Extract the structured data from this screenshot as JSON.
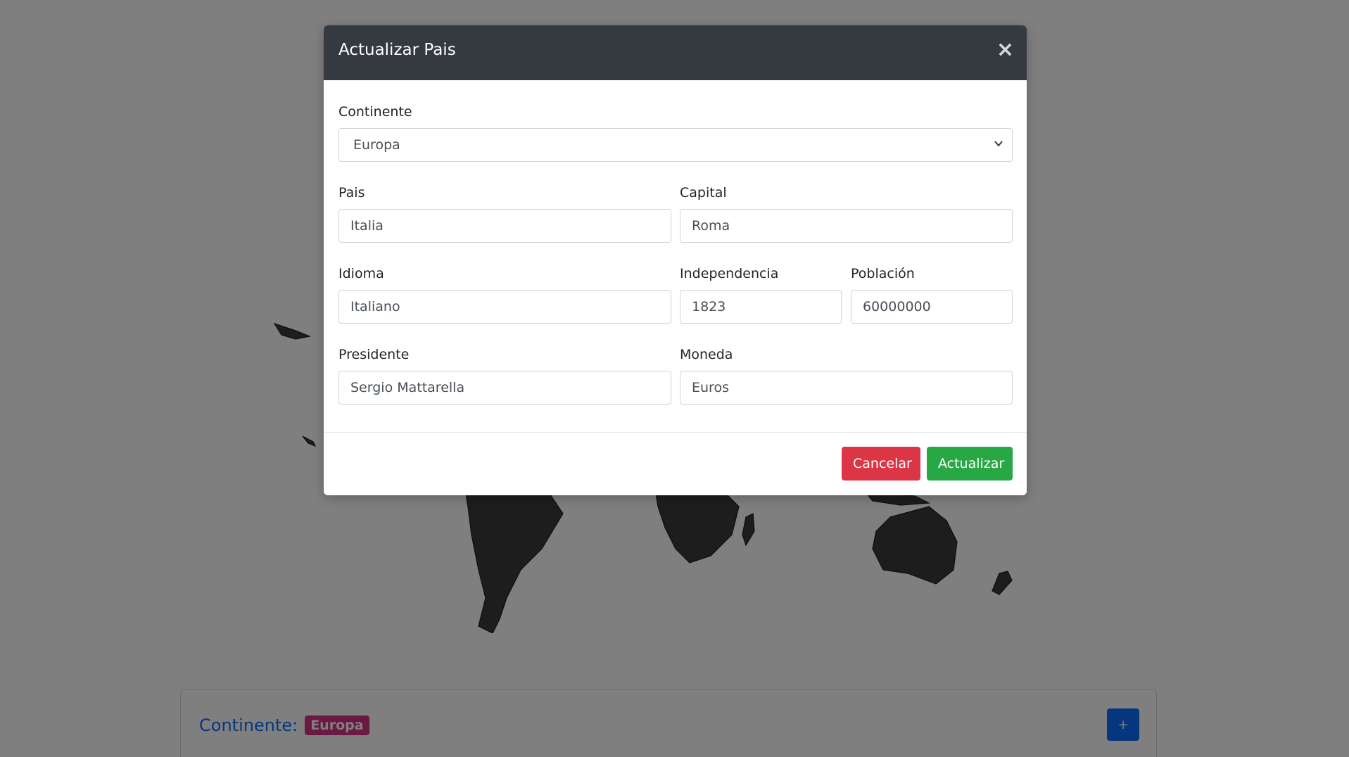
{
  "modal": {
    "title": "Actualizar Pais",
    "close_glyph": "×",
    "fields": {
      "continente": {
        "label": "Continente",
        "value": "Europa"
      },
      "pais": {
        "label": "Pais",
        "value": "Italia"
      },
      "capital": {
        "label": "Capital",
        "value": "Roma"
      },
      "idioma": {
        "label": "Idioma",
        "value": "Italiano"
      },
      "independencia": {
        "label": "Independencia",
        "value": "1823"
      },
      "poblacion": {
        "label": "Población",
        "value": "60000000"
      },
      "presidente": {
        "label": "Presidente",
        "value": "Sergio Mattarella"
      },
      "moneda": {
        "label": "Moneda",
        "value": "Euros"
      }
    },
    "buttons": {
      "cancel": "Cancelar",
      "update": "Actualizar"
    }
  },
  "background": {
    "continent_label": "Continente:",
    "continent_badge": "Europa",
    "add_button": "+"
  },
  "colors": {
    "header_bg": "#343a40",
    "cancel_bg": "#dc3545",
    "update_bg": "#28a745",
    "badge_bg": "#d63384",
    "add_bg": "#0d6efd"
  }
}
